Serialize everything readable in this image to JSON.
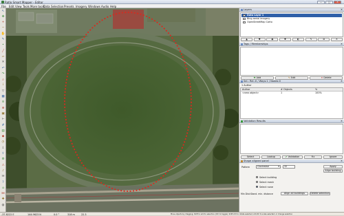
{
  "window": {
    "title": "Ratlo Smart Mapper - Editor",
    "controls": [
      "—",
      "□",
      "✕"
    ]
  },
  "menu": [
    "File",
    "Edit",
    "View",
    "Tools",
    "More tools",
    "Data",
    "Selection",
    "Presets",
    "Imagery",
    "Windows",
    "Audio",
    "Help"
  ],
  "left_toolbar_icons": [
    "select-icon",
    "move-icon",
    "zoom-in-icon",
    "zoom-out-icon",
    "hand-icon",
    "pencil-icon",
    "node-icon",
    "way-icon",
    "area-icon",
    "delete-icon",
    "undo-icon",
    "redo-icon",
    "search-icon",
    "info-icon",
    "filter-icon",
    "map-icon",
    "layers-icon",
    "gps-icon",
    "photo-icon",
    "ruler-icon",
    "grid-icon",
    "lock-icon",
    "bookmark-icon",
    "history-icon",
    "download-icon",
    "upload-icon",
    "settings-icon",
    "warning-icon",
    "audio-icon",
    "chat-icon",
    "help-icon",
    "tag-icon",
    "relation-icon",
    "plugin-icon",
    "globe-icon"
  ],
  "layers_panel": {
    "title": "Layers",
    "items": [
      {
        "label": "Data Layer 1",
        "selected": true,
        "visible": true
      },
      {
        "label": "Bing aerial imagery",
        "selected": false,
        "visible": true
      },
      {
        "label": "OpenStreetMap Carto",
        "selected": false,
        "visible": true
      }
    ],
    "buttons": [
      "▲",
      "▼",
      "◉",
      "✚",
      "◐",
      "✎",
      "⧉",
      "✕"
    ]
  },
  "tags_panel": {
    "title": "Tags / Memberships",
    "buttons": [
      "Add",
      "Edit",
      "Delete"
    ],
    "tag_rows": []
  },
  "selection_panel": {
    "title": "Sel.: Rel.:0 / Ways:1 / Nodes:0",
    "row2": "1 Author",
    "columns": [
      "Author",
      "# Objects",
      "%"
    ],
    "rows": [
      {
        "author": "<new object>",
        "count": "1",
        "percent": "100%"
      }
    ]
  },
  "validation_panel": {
    "title": "Validation Results",
    "buttons": [
      "Select",
      "Lookup",
      "Validation",
      "Fix",
      "Ignore"
    ]
  },
  "shape_panel": {
    "title": "Shape aligned panel",
    "pattern_label": "Pattern",
    "pattern_value": "Clockwise",
    "count_value": "32",
    "apply_label": "Apply",
    "align_label": "Align building",
    "options": [
      "Select building",
      "Select mesh",
      "Select none"
    ],
    "selected_option": 2,
    "min_dist_label": "Min Dist:",
    "min_dist_value": "Stand. min. distance",
    "align_all_label": "Align all buildings",
    "delete_label": "Delete selection"
  },
  "status": {
    "lat": "-37.8222 E",
    "lon": "144.9623 N",
    "heading": "0.0 °",
    "length": "318 m",
    "zoom": "22.3",
    "message": "Move objects by dragging; Shift to add to selection (Ctrl to toggle); Shift-Ctrl to rotate selected; Alt-Ctrl to scale selected; or change selection"
  },
  "colors": {
    "ellipse": "#d92a1e",
    "selected_layer": "#2f5fa8",
    "grass": "#4e6a34"
  }
}
